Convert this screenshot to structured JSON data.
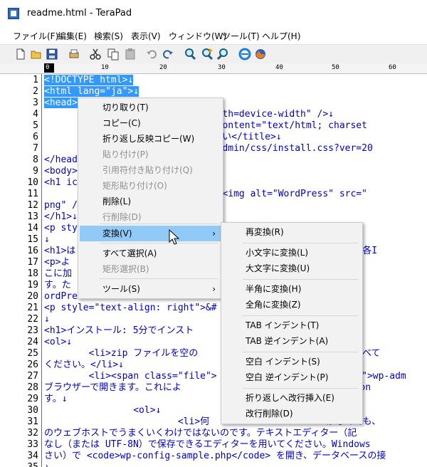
{
  "window": {
    "title": "readme.html - TeraPad"
  },
  "menubar": [
    "ファイル(F)",
    "編集(E)",
    "検索(S)",
    "表示(V)",
    "ウィンドウ(W)",
    "ツール(T)",
    "ヘルプ(H)"
  ],
  "toolbar": {
    "icons": [
      "new-file-icon",
      "open-folder-icon",
      "save-icon",
      "print-icon",
      "cut-icon",
      "copy-icon",
      "paste-icon",
      "undo-icon",
      "redo-icon",
      "find-icon",
      "find-next-icon",
      "find-prev-icon",
      "internet-explorer-icon",
      "firefox-icon"
    ]
  },
  "ruler": {
    "labels": [
      "0",
      "10",
      "20",
      "30",
      "40",
      "50",
      "60"
    ]
  },
  "editor": {
    "line_numbers": [
      "1",
      "2",
      "3",
      "4",
      "5",
      "6",
      "7",
      "8",
      "9",
      "10",
      "11",
      "12",
      "13",
      "14",
      "15",
      "16",
      "17",
      "18",
      "19",
      "20",
      "21",
      "22",
      "23",
      "24",
      "25",
      "26",
      "27",
      "28",
      "29",
      "30",
      "31",
      "32",
      "33",
      "34",
      "35"
    ],
    "lines": [
      {
        "sel": "<!DOCTYPE html>↓",
        "rest": ""
      },
      {
        "sel": "<html lang=\"ja\">↓",
        "rest": ""
      },
      {
        "sel": "<head>",
        "rest": "↓"
      },
      {
        "sel": "",
        "rest": "                    content=\"width=device-width\" />↓"
      },
      {
        "sel": "",
        "rest": "                      nt-Type\" content=\"text/html; charset"
      },
      {
        "sel": "",
        "rest": "                    : お読みください</title>↓"
      },
      {
        "sel": "",
        "rest": "                      href=\"wp-admin/css/install.css?ver=20"
      },
      {
        "sel": "",
        "rest": "</head"
      },
      {
        "sel": "",
        "rest": "<body>"
      },
      {
        "sel": "",
        "rest": "<h1 ic"
      },
      {
        "sel": "",
        "rest": "                      ess.org/\"><img alt=\"WordPress\" src=\""
      },
      {
        "sel": "",
        "rest": "png\" /"
      },
      {
        "sel": "",
        "rest": "</h1>↓"
      },
      {
        "sel": "",
        "rest": "<p sty                                         信プラットフ"
      },
      {
        "sel": "",
        "rest": "↓"
      },
      {
        "sel": "",
        "rest": "<h1>は                                             トです。各I"
      },
      {
        "sel": "",
        "rest": "<p>よ"
      },
      {
        "sel": "",
        "rest": "こに加                                          はその一覧を"
      },
      {
        "sel": "",
        "rest": "す。た                                          にしようと私"
      },
      {
        "sel": "",
        "rest": "ordPre"
      },
      {
        "sel": "",
        "rest": "<p style=\"text-align: right\">&#"
      },
      {
        "sel": "",
        "rest": "↓"
      },
      {
        "sel": "",
        "rest": "<h1>インストール: 5分でインスト"
      },
      {
        "sel": "",
        "rest": "<ol>↓"
      },
      {
        "sel": "",
        "rest": "        <li>zip ファイルを空の                       そしてすべて"
      },
      {
        "sel": "",
        "rest": "ください。</li>↓"
      },
      {
        "sel": "",
        "rest": "        <li><span class=\"file\">                      .php\">wp-adm"
      },
      {
        "sel": "",
        "rest": "ブラウザーで開きます。これによ                      <code>wp-con"
      },
      {
        "sel": "",
        "rest": "す。↓"
      },
      {
        "sel": "",
        "rest": "                <ol>↓"
      },
      {
        "sel": "",
        "rest": "                        <li>何                     かなくても、"
      },
      {
        "sel": "",
        "rest": "のウェブホストでうまくいくわけではないのです。テキストエディター（記"
      },
      {
        "sel": "",
        "rest": "なし（または UTF-8N）で保存できるエディターを用いてください。Windows"
      },
      {
        "sel": "",
        "rest": "さい）で <code>wp-config-sample.php</code> を開き、データベースの接"
      },
      {
        "sel": "",
        "rest": "↓"
      }
    ]
  },
  "context_menu": {
    "items": [
      {
        "label": "切り取り(T)",
        "disabled": false
      },
      {
        "label": "コピー(C)",
        "disabled": false
      },
      {
        "label": "折り返し反映コピー(W)",
        "disabled": false
      },
      {
        "label": "貼り付け(P)",
        "disabled": true
      },
      {
        "label": "引用符付き貼り付け(Q)",
        "disabled": true
      },
      {
        "label": "矩形貼り付け(O)",
        "disabled": true
      },
      {
        "label": "削除(L)",
        "disabled": false
      },
      {
        "label": "行削除(D)",
        "disabled": true
      },
      {
        "label": "変換(V)",
        "disabled": false,
        "submenu": true
      },
      {
        "label": "すべて選択(A)",
        "disabled": false
      },
      {
        "label": "矩形選択(B)",
        "disabled": true
      },
      {
        "label": "ツール(S)",
        "disabled": false,
        "submenu": true
      }
    ],
    "submenu_arrow": "›"
  },
  "sub_menu": {
    "items": [
      {
        "label": "再変換(R)"
      },
      {
        "label": "小文字に変換(L)"
      },
      {
        "label": "大文字に変換(U)"
      },
      {
        "label": "半角に変換(H)"
      },
      {
        "label": "全角に変換(Z)"
      },
      {
        "label": "TAB インデント(T)"
      },
      {
        "label": "TAB 逆インデント(A)"
      },
      {
        "label": "空白 インデント(S)"
      },
      {
        "label": "空白 逆インデント(P)"
      },
      {
        "label": "折り返しへ改行挿入(E)"
      },
      {
        "label": "改行削除(D)"
      }
    ]
  },
  "colors": {
    "selection": "#3399ff",
    "tag": "#0000cc",
    "highlight": "#91c9f7"
  }
}
